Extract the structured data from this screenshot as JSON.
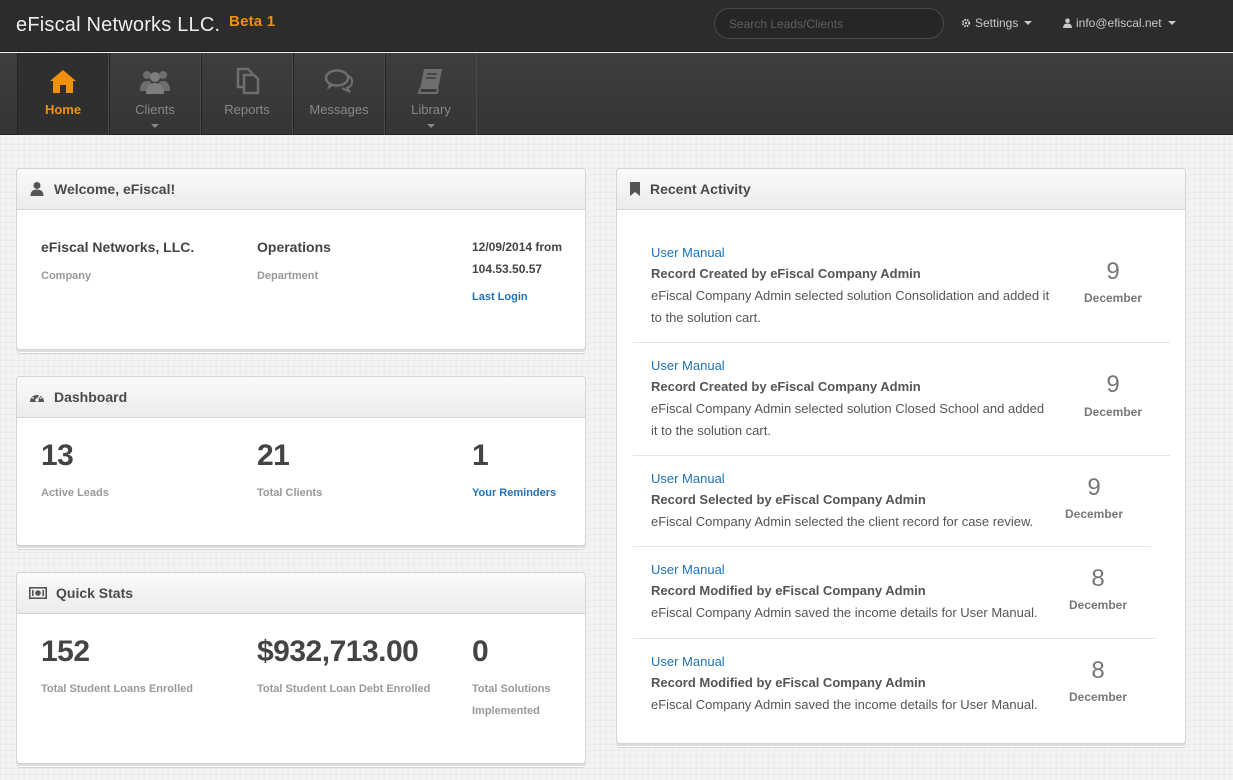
{
  "brand": {
    "name": "eFiscal Networks LLC.",
    "badge": "Beta 1"
  },
  "search": {
    "placeholder": "Search Leads/Clients"
  },
  "topnav": {
    "settings_label": "Settings",
    "user_label": "info@efiscal.net"
  },
  "nav": [
    {
      "label": "Home",
      "icon": "home-icon",
      "active": true
    },
    {
      "label": "Clients",
      "icon": "users-icon"
    },
    {
      "label": "Reports",
      "icon": "copy-icon"
    },
    {
      "label": "Messages",
      "icon": "comments-icon"
    },
    {
      "label": "Library",
      "icon": "book-icon"
    }
  ],
  "welcome": {
    "title": "Welcome, eFiscal!",
    "company": "eFiscal Networks, LLC.",
    "company_label": "Company",
    "department": "Operations",
    "department_label": "Department",
    "last_login_line1": "12/09/2014 from",
    "last_login_line2": "104.53.50.57",
    "last_login_label": "Last Login"
  },
  "dashboard": {
    "title": "Dashboard",
    "active_leads": "13",
    "active_leads_label": "Active Leads",
    "total_clients": "21",
    "total_clients_label": "Total Clients",
    "reminders": "1",
    "reminders_label": "Your Reminders"
  },
  "quick_stats": {
    "title": "Quick Stats",
    "loans": "152",
    "loans_label": "Total Student Loans Enrolled",
    "debt": "$932,713.00",
    "debt_label": "Total Student Loan Debt Enrolled",
    "solutions": "0",
    "solutions_label_1": "Total Solutions",
    "solutions_label_2": "Implemented"
  },
  "activity": {
    "title": "Recent Activity",
    "items": [
      {
        "link": "User Manual",
        "title": "Record Created by eFiscal Company Admin",
        "desc1": "eFiscal Company Admin selected solution Consolidation and added it",
        "desc2": "to the solution cart.",
        "day": "9",
        "month": "December"
      },
      {
        "link": "User Manual",
        "title": "Record Created by eFiscal Company Admin",
        "desc1": "eFiscal Company Admin selected solution Closed School and added",
        "desc2": "it to the solution cart.",
        "day": "9",
        "month": "December"
      },
      {
        "link": "User Manual",
        "title": "Record Selected by eFiscal Company Admin",
        "desc1": "eFiscal Company Admin selected the client record for case review.",
        "desc2": "",
        "day": "9",
        "month": "December"
      },
      {
        "link": "User Manual",
        "title": "Record Modified by eFiscal Company Admin",
        "desc1": "eFiscal Company Admin saved the income details for User Manual.",
        "desc2": "",
        "day": "8",
        "month": "December"
      },
      {
        "link": "User Manual",
        "title": "Record Modified by eFiscal Company Admin",
        "desc1": "eFiscal Company Admin saved the income details for User Manual.",
        "desc2": "",
        "day": "8",
        "month": "December"
      }
    ]
  },
  "colors": {
    "accent": "#f0900e",
    "link": "#1d72b8",
    "topbar": "#2c2c2c"
  }
}
